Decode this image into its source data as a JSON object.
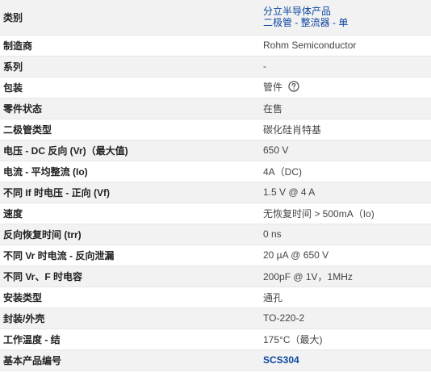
{
  "specs": {
    "rows": [
      {
        "label": "类别",
        "links": [
          "分立半导体产品",
          "二极管 - 整流器 - 单"
        ]
      },
      {
        "label": "制造商",
        "value": "Rohm Semiconductor"
      },
      {
        "label": "系列",
        "value": "-"
      },
      {
        "label": "包装",
        "value": "管件",
        "icon": "help-circle-icon"
      },
      {
        "label": "零件状态",
        "value": "在售"
      },
      {
        "label": "二极管类型",
        "value": "碳化硅肖特基"
      },
      {
        "label": "电压 - DC 反向 (Vr)（最大值)",
        "value": "650 V"
      },
      {
        "label": "电流 - 平均整流 (Io)",
        "value": "4A（DC)"
      },
      {
        "label": "不同 If 时电压 - 正向 (Vf)",
        "value": "1.5 V @ 4 A"
      },
      {
        "label": "速度",
        "value": "无恢复时间 > 500mA（Io)"
      },
      {
        "label": "反向恢复时间 (trr)",
        "value": "0 ns"
      },
      {
        "label": "不同 Vr 时电流 - 反向泄漏",
        "value": "20 µA @ 650 V"
      },
      {
        "label": "不同 Vr、F 时电容",
        "value": "200pF @ 1V，1MHz"
      },
      {
        "label": "安装类型",
        "value": "通孔"
      },
      {
        "label": "封装/外壳",
        "value": "TO-220-2"
      },
      {
        "label": "工作温度 - 结",
        "value": "175°C（最大)"
      },
      {
        "label": "基本产品编号",
        "link": "SCS304"
      }
    ]
  },
  "colors": {
    "link": "#0d47a1",
    "alt_row_background": "#f2f2f2",
    "label_text": "#222222",
    "value_text": "#444444"
  }
}
